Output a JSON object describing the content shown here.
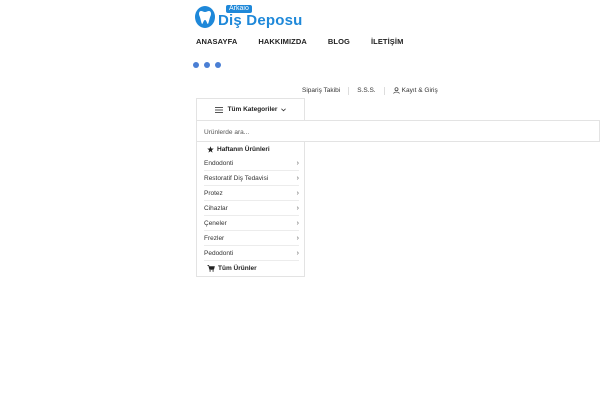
{
  "logo": {
    "small_text": "Arkaio",
    "big_text": "Diş Deposu",
    "icon": "tooth-icon",
    "color": "#1e88d9"
  },
  "nav": {
    "items": [
      {
        "label": "ANASAYFA"
      },
      {
        "label": "HAKKIMIZDA"
      },
      {
        "label": "BLOG"
      },
      {
        "label": "İLETİŞİM"
      }
    ]
  },
  "loader": {
    "color": "#4a7fd4",
    "icon": "loading-dots-icon"
  },
  "top_links": {
    "order_tracking": "Sipariş Takibi",
    "faq": "S.S.S.",
    "login": "Kayıt & Giriş",
    "login_icon": "user-icon"
  },
  "categories": {
    "button_label": "Tüm Kategoriler",
    "button_icon": "hamburger-icon",
    "weekly_label": "Haftanın Ürünleri",
    "weekly_icon": "star-icon",
    "items": [
      {
        "label": "Endodonti"
      },
      {
        "label": "Restoratif Diş Tedavisi"
      },
      {
        "label": "Protez"
      },
      {
        "label": "Cihazlar"
      },
      {
        "label": "Çeneler"
      },
      {
        "label": "Frezler"
      },
      {
        "label": "Pedodonti"
      }
    ],
    "all_label": "Tüm Ürünler",
    "all_icon": "cart-icon"
  },
  "search": {
    "placeholder": "Ürünlerde ara..."
  }
}
